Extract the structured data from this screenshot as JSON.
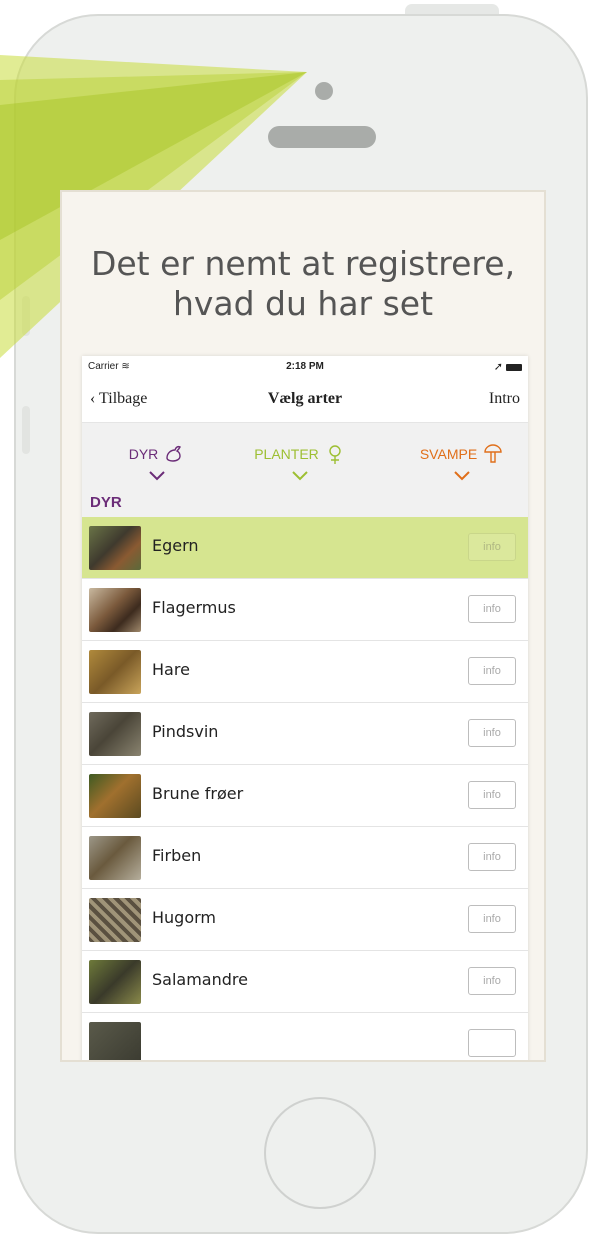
{
  "promo": {
    "headline_line1": "Det er nemt at registrere,",
    "headline_line2": "hvad du har set"
  },
  "status_bar": {
    "carrier": "Carrier",
    "time": "2:18 PM"
  },
  "nav": {
    "back_label": "Tilbage",
    "title": "Vælg arter",
    "right_label": "Intro"
  },
  "categories": [
    {
      "label": "DYR",
      "icon": "rabbit-icon",
      "color": "#6b2c78"
    },
    {
      "label": "PLANTER",
      "icon": "flower-icon",
      "color": "#9dbf32"
    },
    {
      "label": "SVAMPE",
      "icon": "mushroom-icon",
      "color": "#e06f1a"
    }
  ],
  "section_label": "DYR",
  "species": [
    {
      "name": "Egern",
      "info": "info",
      "selected": true
    },
    {
      "name": "Flagermus",
      "info": "info",
      "selected": false
    },
    {
      "name": "Hare",
      "info": "info",
      "selected": false
    },
    {
      "name": "Pindsvin",
      "info": "info",
      "selected": false
    },
    {
      "name": "Brune frøer",
      "info": "info",
      "selected": false
    },
    {
      "name": "Firben",
      "info": "info",
      "selected": false
    },
    {
      "name": "Hugorm",
      "info": "info",
      "selected": false
    },
    {
      "name": "Salamandre",
      "info": "info",
      "selected": false
    },
    {
      "name": "",
      "info": "",
      "selected": false
    }
  ],
  "colors": {
    "accent_green": "#c8dc3c",
    "selected_row": "#d6e590",
    "phone_body": "#eef0ee"
  }
}
